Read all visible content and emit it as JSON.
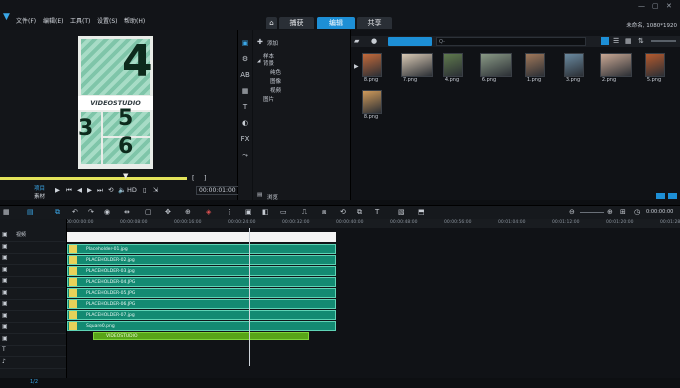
{
  "menu": [
    "文件(F)",
    "编辑(E)",
    "工具(T)",
    "设置(S)",
    "帮助(H)"
  ],
  "workspace_tabs": [
    "捕获",
    "编辑",
    "共享"
  ],
  "active_tab": "编辑",
  "project_name": "未命名, 1080*1920",
  "preview": {
    "big_number_top": "4",
    "banner_text": "VIDEOSTUDIO",
    "num_3": "3",
    "num_5": "5",
    "num_6": "6",
    "mode_project": "项目",
    "mode_clip": "素材",
    "hd_label": "HD",
    "timecode": "00:00:01:00"
  },
  "library": {
    "add_label": "添加",
    "tree": [
      "样本",
      "背景",
      "纯色",
      "图像",
      "视频",
      "图片"
    ],
    "browse_label": "浏览",
    "search_placeholder": "Q-",
    "thumbs": [
      {
        "label": "8.png",
        "color": "#c46a3a"
      },
      {
        "label": "7.png",
        "color": "#d9c9b4"
      },
      {
        "label": "4.png",
        "color": "#5f7a4d"
      },
      {
        "label": "6.png",
        "color": "#8a9a86"
      },
      {
        "label": "1.png",
        "color": "#a0785a"
      },
      {
        "label": "3.png",
        "color": "#6a8aa0"
      },
      {
        "label": "2.png",
        "color": "#c9a894"
      },
      {
        "label": "5.png",
        "color": "#b55a2e"
      },
      {
        "label": "8.png",
        "color": "#cf9a5a"
      }
    ]
  },
  "timeline": {
    "ruler": [
      "00:00:00:00",
      "00:00:08:00",
      "00:00:16:00",
      "00:00:24:00",
      "00:00:32:00",
      "00:00:40:00",
      "00:00:48:00",
      "00:00:56:00",
      "00:01:04:00",
      "00:01:12:00",
      "00:01:20:00",
      "00:01:28:00"
    ],
    "timecode_right": "0:00:00:00",
    "track_label": "视频",
    "clips": [
      "Placeholder-01.jpg",
      "PLACEHOLDER-02.jpg",
      "PLACEHOLDER-03.jpg",
      "PLACEHOLDER-04.JPG",
      "PLACEHOLDER-05.JPG",
      "PLACEHOLDER-06.JPG",
      "PLACEHOLDER-07.jpg",
      "Square0.png"
    ],
    "title_clip": "VIDEOSTUDIO",
    "zoom_label": "1/2"
  }
}
